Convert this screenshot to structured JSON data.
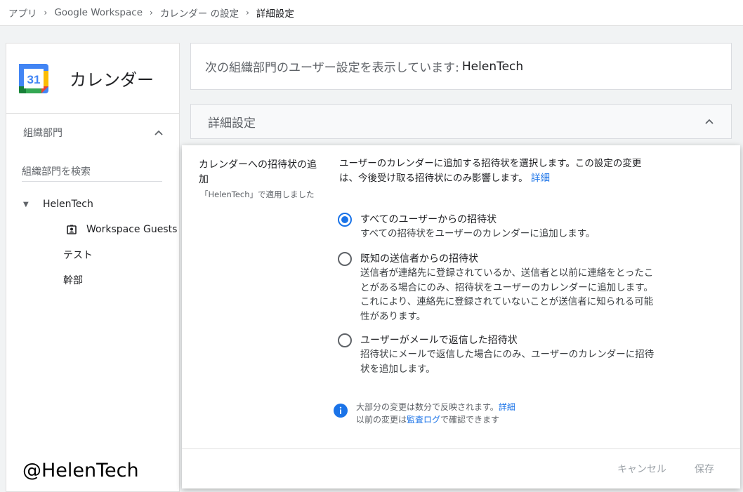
{
  "breadcrumb": [
    "アプリ",
    "Google Workspace",
    "カレンダー の設定",
    "詳細設定"
  ],
  "sidebar": {
    "app_name": "カレンダー",
    "logo_day": "31",
    "org_heading": "組織部門",
    "search_placeholder": "組織部門を検索",
    "tree": {
      "root": "HelenTech",
      "guest": "Workspace Guests",
      "child1": "テスト",
      "child2": "幹部"
    }
  },
  "watermark": "@HelenTech",
  "info": {
    "prefix": "次の組織部門のユーザー設定を表示しています:",
    "org": "HelenTech"
  },
  "section": {
    "title": "詳細設定"
  },
  "setting": {
    "label": "カレンダーへの招待状の追加",
    "applied": "「HelenTech」で適用しました",
    "description": "ユーザーのカレンダーに追加する招待状を選択します。この設定の変更は、今後受け取る招待状にのみ影響します。",
    "details_link": "詳細",
    "options": [
      {
        "title": "すべてのユーザーからの招待状",
        "desc": "すべての招待状をユーザーのカレンダーに追加します。",
        "selected": true
      },
      {
        "title": "既知の送信者からの招待状",
        "desc": "送信者が連絡先に登録されているか、送信者と以前に連絡をとったことがある場合にのみ、招待状をユーザーのカレンダーに追加します。これにより、連絡先に登録されていないことが送信者に知られる可能性があります。",
        "selected": false
      },
      {
        "title": "ユーザーがメールで返信した招待状",
        "desc": "招待状にメールで返信した場合にのみ、ユーザーのカレンダーに招待状を追加します。",
        "selected": false
      }
    ],
    "note_line1": "大部分の変更は数分で反映されます。",
    "note_link1": "詳細",
    "note_line2a": "以前の変更は",
    "note_link2": "監査ログ",
    "note_line2b": "で確認できます"
  },
  "buttons": {
    "cancel": "キャンセル",
    "save": "保存"
  },
  "colors": {
    "accent": "#1a73e8",
    "info_icon": "#1a73e8"
  }
}
